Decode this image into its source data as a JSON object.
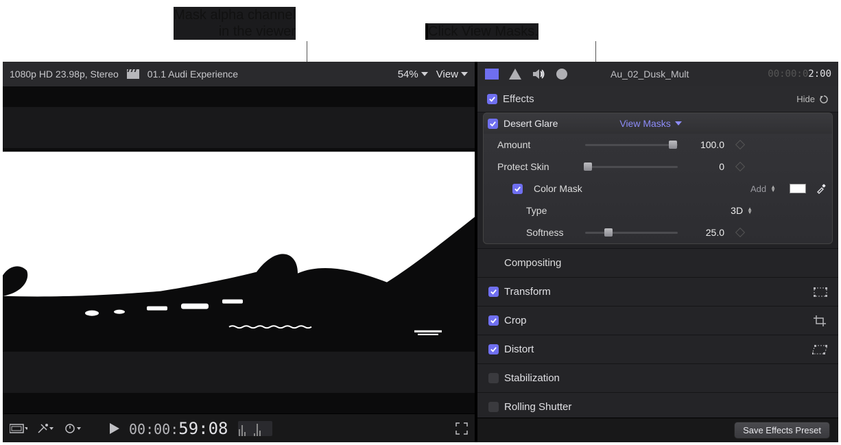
{
  "callouts": {
    "left_line1": "Mask alpha channel",
    "left_line2": "in the viewer",
    "right": "Click View Masks."
  },
  "viewer": {
    "format": "1080p HD 23.98p, Stereo",
    "project": "01.1 Audi Experience",
    "zoom": "54%",
    "view_label": "View"
  },
  "transport": {
    "tc_small": "00:00:",
    "tc_big": "59:08"
  },
  "inspector": {
    "clip_name": "Au_02_Dusk_Mult",
    "tc_dim": "00:00:0",
    "tc_lit": "2:00",
    "effects_label": "Effects",
    "hide_label": "Hide",
    "effect": {
      "name": "Desert Glare",
      "view_masks": "View Masks",
      "params": {
        "amount_label": "Amount",
        "amount_value": "100.0",
        "protect_label": "Protect Skin",
        "protect_value": "0",
        "colormask_label": "Color Mask",
        "add_label": "Add",
        "type_label": "Type",
        "type_value": "3D",
        "softness_label": "Softness",
        "softness_value": "25.0"
      }
    },
    "sections": {
      "compositing": "Compositing",
      "transform": "Transform",
      "crop": "Crop",
      "distort": "Distort",
      "stabilization": "Stabilization",
      "rolling_shutter": "Rolling Shutter"
    },
    "preset_btn": "Save Effects Preset"
  }
}
